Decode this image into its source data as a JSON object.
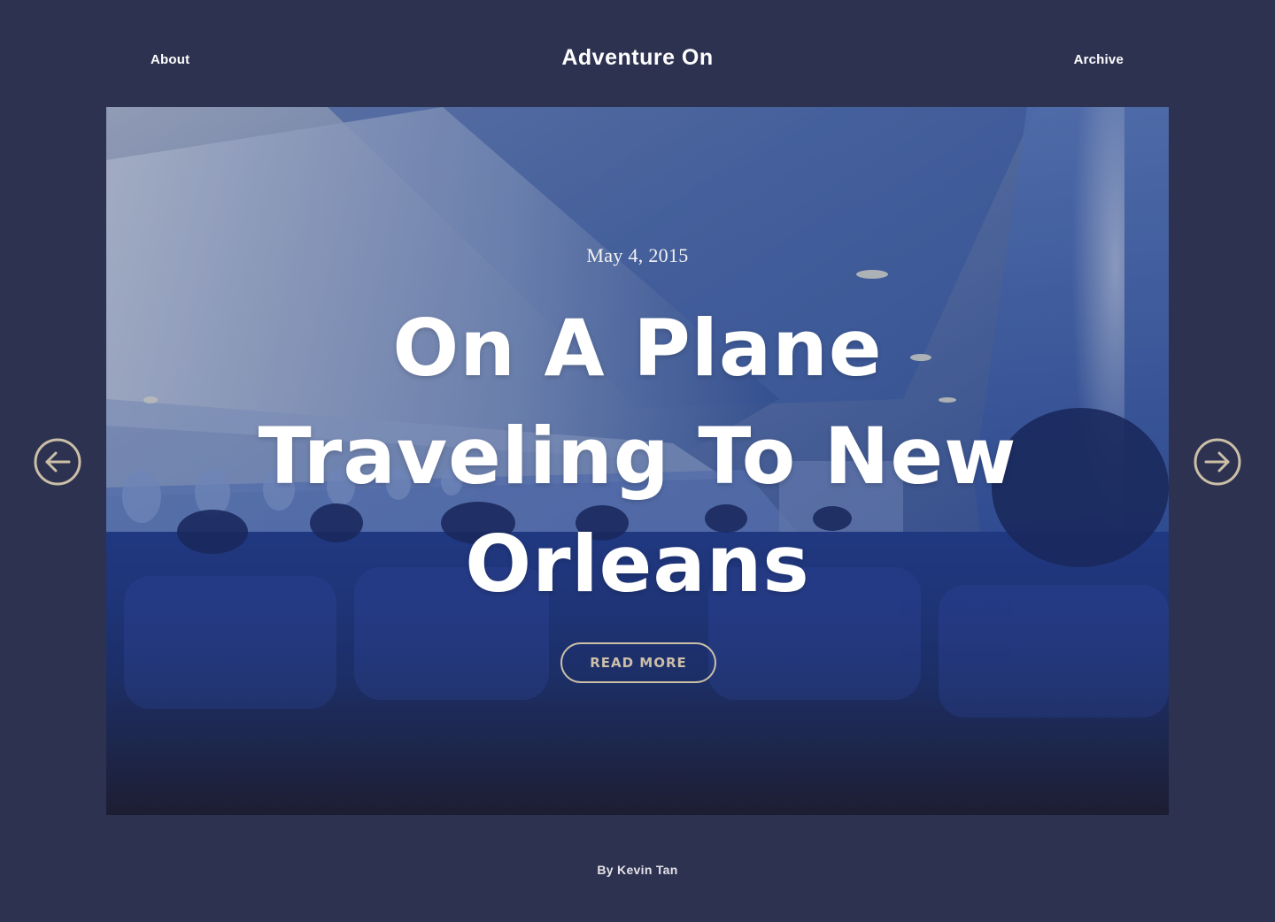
{
  "header": {
    "left_link": "About",
    "site_title": "Adventure On",
    "right_link": "Archive"
  },
  "post": {
    "date": "May 4, 2015",
    "title": "On A Plane Traveling To New Orleans",
    "read_more_label": "READ MORE",
    "byline": "By Kevin Tan"
  },
  "navigation": {
    "prev_icon": "arrow-left-circle-icon",
    "next_icon": "arrow-right-circle-icon"
  },
  "colors": {
    "page_background": "#2d3250",
    "accent": "#cbbfa8",
    "hero_overlay": "#1f3f85"
  }
}
